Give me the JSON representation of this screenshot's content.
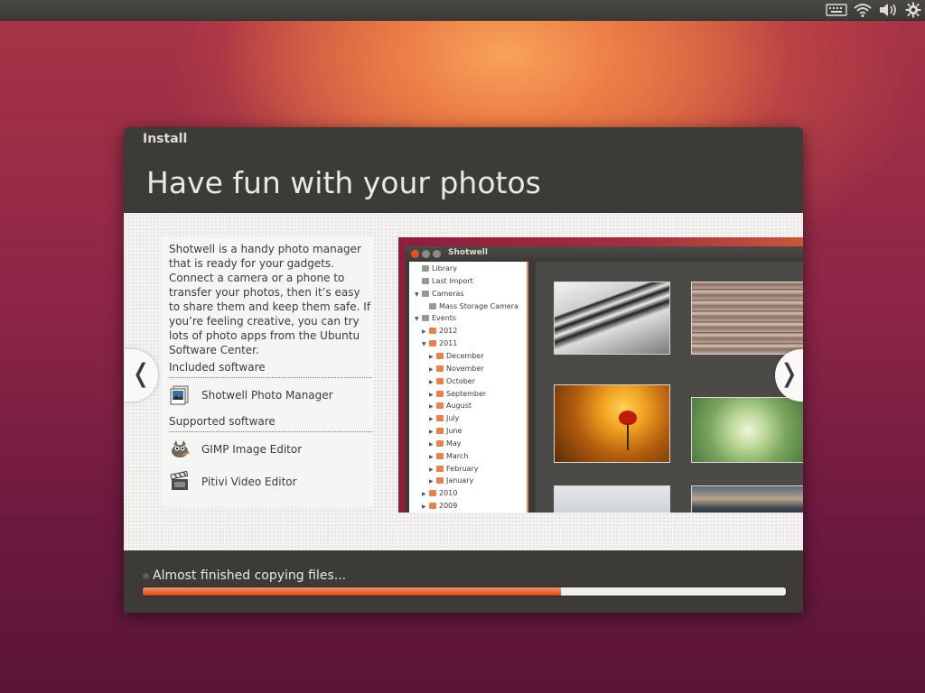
{
  "window": {
    "title": "Install",
    "headline": "Have fun with your photos"
  },
  "slide": {
    "description": "Shotwell is a handy photo manager that is ready for your gadgets. Connect a camera or a phone to transfer your photos, then it’s easy to share them and keep them safe. If you’re feeling creative, you can try lots of photo apps from the Ubuntu Software Center.",
    "included_title": "Included software",
    "included": [
      {
        "name": "Shotwell Photo Manager",
        "icon": "shotwell-icon"
      }
    ],
    "supported_title": "Supported software",
    "supported": [
      {
        "name": "GIMP Image Editor",
        "icon": "gimp-icon"
      },
      {
        "name": "Pitivi Video Editor",
        "icon": "pitivi-icon"
      }
    ],
    "prev_glyph": "❬",
    "next_glyph": "❭"
  },
  "shotwell": {
    "title": "Shotwell",
    "tree": [
      {
        "label": "Library",
        "indent": 0,
        "icon": "library",
        "twisty": ""
      },
      {
        "label": "Last Import",
        "indent": 0,
        "icon": "import",
        "twisty": ""
      },
      {
        "label": "Cameras",
        "indent": 0,
        "icon": "camera",
        "twisty": "▼"
      },
      {
        "label": "Mass Storage Camera",
        "indent": 1,
        "icon": "camera",
        "twisty": ""
      },
      {
        "label": "Events",
        "indent": 0,
        "icon": "events",
        "twisty": "▼"
      },
      {
        "label": "2012",
        "indent": 1,
        "icon": "folder",
        "twisty": "▶"
      },
      {
        "label": "2011",
        "indent": 1,
        "icon": "folder",
        "twisty": "▼"
      },
      {
        "label": "December",
        "indent": 2,
        "icon": "folder",
        "twisty": "▶"
      },
      {
        "label": "November",
        "indent": 2,
        "icon": "folder",
        "twisty": "▶"
      },
      {
        "label": "October",
        "indent": 2,
        "icon": "folder",
        "twisty": "▶"
      },
      {
        "label": "September",
        "indent": 2,
        "icon": "folder",
        "twisty": "▶"
      },
      {
        "label": "August",
        "indent": 2,
        "icon": "folder",
        "twisty": "▶"
      },
      {
        "label": "July",
        "indent": 2,
        "icon": "folder",
        "twisty": "▶"
      },
      {
        "label": "June",
        "indent": 2,
        "icon": "folder",
        "twisty": "▶"
      },
      {
        "label": "May",
        "indent": 2,
        "icon": "folder",
        "twisty": "▶"
      },
      {
        "label": "March",
        "indent": 2,
        "icon": "folder",
        "twisty": "▶"
      },
      {
        "label": "February",
        "indent": 2,
        "icon": "folder",
        "twisty": "▶"
      },
      {
        "label": "January",
        "indent": 2,
        "icon": "folder",
        "twisty": "▶"
      },
      {
        "label": "2010",
        "indent": 1,
        "icon": "folder",
        "twisty": "▶"
      },
      {
        "label": "2009",
        "indent": 1,
        "icon": "folder",
        "twisty": "▶"
      }
    ],
    "photos": [
      "piano-keys-photo",
      "roof-tiles-photo",
      "red-poppy-sunset-photo",
      "green-succulent-photo",
      "misty-landscape-photo",
      "dusk-sea-photo"
    ]
  },
  "progress": {
    "text": "Almost finished copying files...",
    "fraction": 0.65
  },
  "tray": {
    "icons": [
      "keyboard-icon",
      "wifi-icon",
      "volume-icon",
      "settings-gear-icon"
    ]
  },
  "colors": {
    "accent": "#dd4814",
    "window_bg": "#3c3b37",
    "panel_bg": "#f3f2f0"
  }
}
